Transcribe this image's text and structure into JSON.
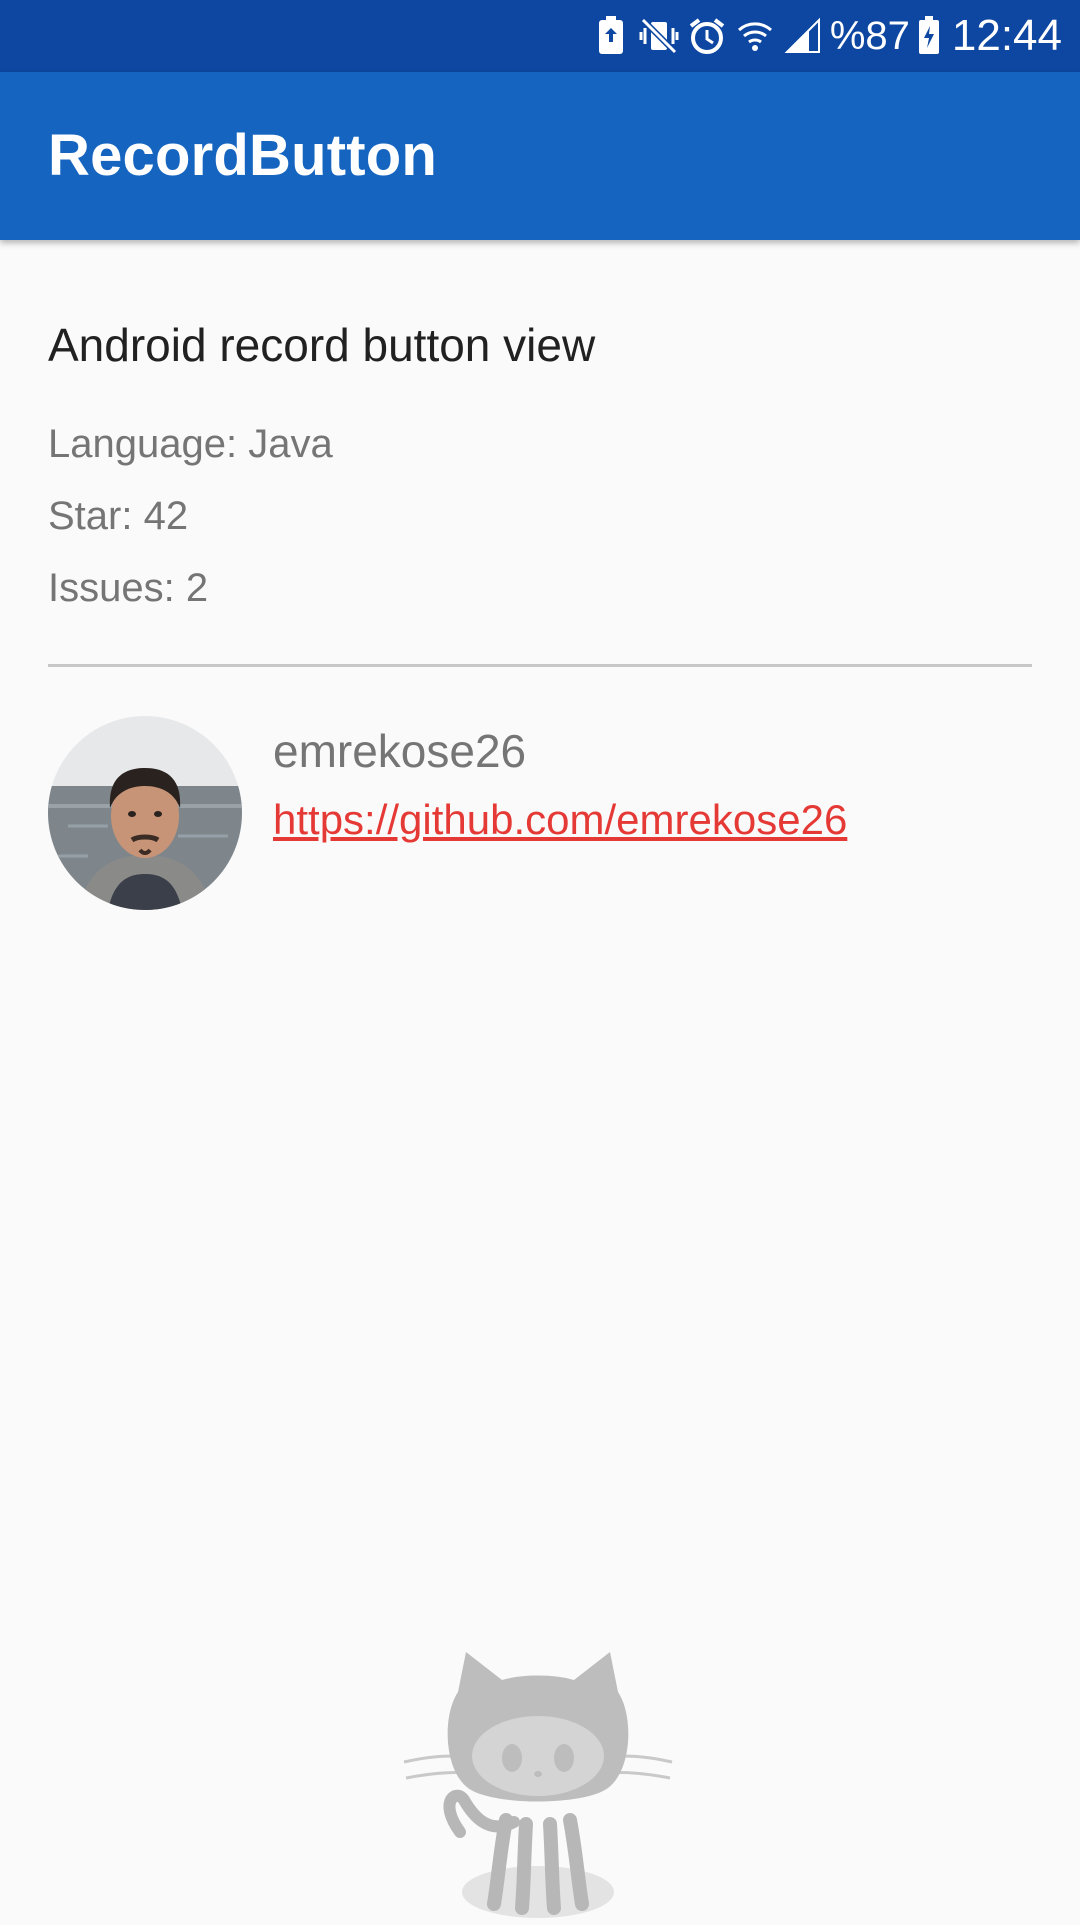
{
  "status_bar": {
    "battery_percent": "%87",
    "time": "12:44",
    "icons": [
      "battery-saver-icon",
      "vibrate-mute-icon",
      "alarm-icon",
      "wifi-icon",
      "signal-icon",
      "battery-icon"
    ]
  },
  "app_bar": {
    "title": "RecordButton"
  },
  "repo": {
    "description": "Android record button view",
    "language": "Language: Java",
    "stars": "Star: 42",
    "issues": "Issues: 2"
  },
  "owner": {
    "name": "emrekose26",
    "url": "https://github.com/emrekose26"
  },
  "colors": {
    "status_bar": "#0d47a1",
    "app_bar": "#1565c0",
    "link": "#e53935",
    "background": "#fafafa"
  }
}
